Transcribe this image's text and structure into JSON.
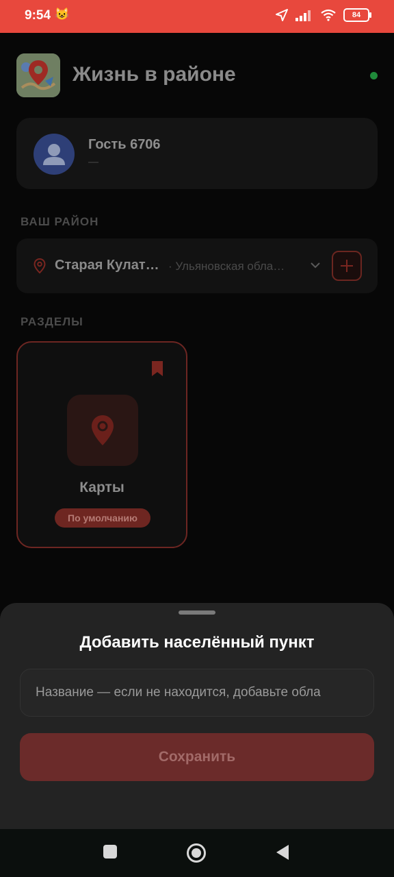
{
  "status_bar": {
    "time": "9:54",
    "emoji": "😺",
    "battery": "84",
    "accent_color": "#e8483d"
  },
  "app": {
    "title": "Жизнь в районе",
    "online_color": "#1f8a3a"
  },
  "user": {
    "name": "Гость 6706",
    "subtitle": "—"
  },
  "district_section": {
    "label": "ВАШ РАЙОН",
    "name": "Старая Кулат…",
    "region": "· Ульяновская обла…"
  },
  "sections": {
    "label": "РАЗДЕЛЫ",
    "tiles": [
      {
        "title": "Карты",
        "badge": "По умолчанию",
        "icon": "map-pin-icon",
        "bookmarked": true
      }
    ]
  },
  "sheet": {
    "title": "Добавить населённый пункт",
    "input_placeholder": "Название — если не находится, добавьте обла",
    "input_value": "",
    "save_label": "Сохранить"
  },
  "navbar": {
    "buttons": [
      "recents-icon",
      "home-icon",
      "back-icon"
    ]
  }
}
